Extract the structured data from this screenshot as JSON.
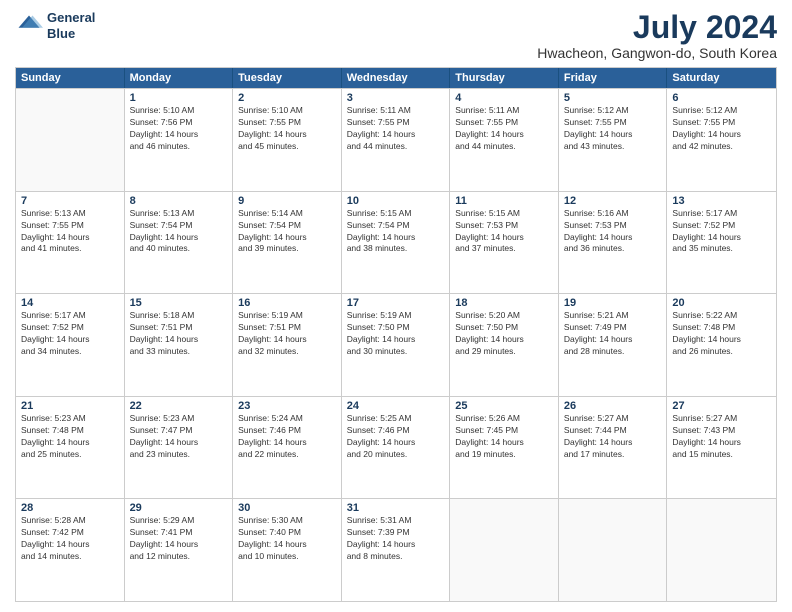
{
  "logo": {
    "line1": "General",
    "line2": "Blue"
  },
  "title": "July 2024",
  "location": "Hwacheon, Gangwon-do, South Korea",
  "days_of_week": [
    "Sunday",
    "Monday",
    "Tuesday",
    "Wednesday",
    "Thursday",
    "Friday",
    "Saturday"
  ],
  "weeks": [
    [
      {
        "day": "",
        "info": ""
      },
      {
        "day": "1",
        "info": "Sunrise: 5:10 AM\nSunset: 7:56 PM\nDaylight: 14 hours\nand 46 minutes."
      },
      {
        "day": "2",
        "info": "Sunrise: 5:10 AM\nSunset: 7:55 PM\nDaylight: 14 hours\nand 45 minutes."
      },
      {
        "day": "3",
        "info": "Sunrise: 5:11 AM\nSunset: 7:55 PM\nDaylight: 14 hours\nand 44 minutes."
      },
      {
        "day": "4",
        "info": "Sunrise: 5:11 AM\nSunset: 7:55 PM\nDaylight: 14 hours\nand 44 minutes."
      },
      {
        "day": "5",
        "info": "Sunrise: 5:12 AM\nSunset: 7:55 PM\nDaylight: 14 hours\nand 43 minutes."
      },
      {
        "day": "6",
        "info": "Sunrise: 5:12 AM\nSunset: 7:55 PM\nDaylight: 14 hours\nand 42 minutes."
      }
    ],
    [
      {
        "day": "7",
        "info": "Sunrise: 5:13 AM\nSunset: 7:55 PM\nDaylight: 14 hours\nand 41 minutes."
      },
      {
        "day": "8",
        "info": "Sunrise: 5:13 AM\nSunset: 7:54 PM\nDaylight: 14 hours\nand 40 minutes."
      },
      {
        "day": "9",
        "info": "Sunrise: 5:14 AM\nSunset: 7:54 PM\nDaylight: 14 hours\nand 39 minutes."
      },
      {
        "day": "10",
        "info": "Sunrise: 5:15 AM\nSunset: 7:54 PM\nDaylight: 14 hours\nand 38 minutes."
      },
      {
        "day": "11",
        "info": "Sunrise: 5:15 AM\nSunset: 7:53 PM\nDaylight: 14 hours\nand 37 minutes."
      },
      {
        "day": "12",
        "info": "Sunrise: 5:16 AM\nSunset: 7:53 PM\nDaylight: 14 hours\nand 36 minutes."
      },
      {
        "day": "13",
        "info": "Sunrise: 5:17 AM\nSunset: 7:52 PM\nDaylight: 14 hours\nand 35 minutes."
      }
    ],
    [
      {
        "day": "14",
        "info": "Sunrise: 5:17 AM\nSunset: 7:52 PM\nDaylight: 14 hours\nand 34 minutes."
      },
      {
        "day": "15",
        "info": "Sunrise: 5:18 AM\nSunset: 7:51 PM\nDaylight: 14 hours\nand 33 minutes."
      },
      {
        "day": "16",
        "info": "Sunrise: 5:19 AM\nSunset: 7:51 PM\nDaylight: 14 hours\nand 32 minutes."
      },
      {
        "day": "17",
        "info": "Sunrise: 5:19 AM\nSunset: 7:50 PM\nDaylight: 14 hours\nand 30 minutes."
      },
      {
        "day": "18",
        "info": "Sunrise: 5:20 AM\nSunset: 7:50 PM\nDaylight: 14 hours\nand 29 minutes."
      },
      {
        "day": "19",
        "info": "Sunrise: 5:21 AM\nSunset: 7:49 PM\nDaylight: 14 hours\nand 28 minutes."
      },
      {
        "day": "20",
        "info": "Sunrise: 5:22 AM\nSunset: 7:48 PM\nDaylight: 14 hours\nand 26 minutes."
      }
    ],
    [
      {
        "day": "21",
        "info": "Sunrise: 5:23 AM\nSunset: 7:48 PM\nDaylight: 14 hours\nand 25 minutes."
      },
      {
        "day": "22",
        "info": "Sunrise: 5:23 AM\nSunset: 7:47 PM\nDaylight: 14 hours\nand 23 minutes."
      },
      {
        "day": "23",
        "info": "Sunrise: 5:24 AM\nSunset: 7:46 PM\nDaylight: 14 hours\nand 22 minutes."
      },
      {
        "day": "24",
        "info": "Sunrise: 5:25 AM\nSunset: 7:46 PM\nDaylight: 14 hours\nand 20 minutes."
      },
      {
        "day": "25",
        "info": "Sunrise: 5:26 AM\nSunset: 7:45 PM\nDaylight: 14 hours\nand 19 minutes."
      },
      {
        "day": "26",
        "info": "Sunrise: 5:27 AM\nSunset: 7:44 PM\nDaylight: 14 hours\nand 17 minutes."
      },
      {
        "day": "27",
        "info": "Sunrise: 5:27 AM\nSunset: 7:43 PM\nDaylight: 14 hours\nand 15 minutes."
      }
    ],
    [
      {
        "day": "28",
        "info": "Sunrise: 5:28 AM\nSunset: 7:42 PM\nDaylight: 14 hours\nand 14 minutes."
      },
      {
        "day": "29",
        "info": "Sunrise: 5:29 AM\nSunset: 7:41 PM\nDaylight: 14 hours\nand 12 minutes."
      },
      {
        "day": "30",
        "info": "Sunrise: 5:30 AM\nSunset: 7:40 PM\nDaylight: 14 hours\nand 10 minutes."
      },
      {
        "day": "31",
        "info": "Sunrise: 5:31 AM\nSunset: 7:39 PM\nDaylight: 14 hours\nand 8 minutes."
      },
      {
        "day": "",
        "info": ""
      },
      {
        "day": "",
        "info": ""
      },
      {
        "day": "",
        "info": ""
      }
    ]
  ]
}
